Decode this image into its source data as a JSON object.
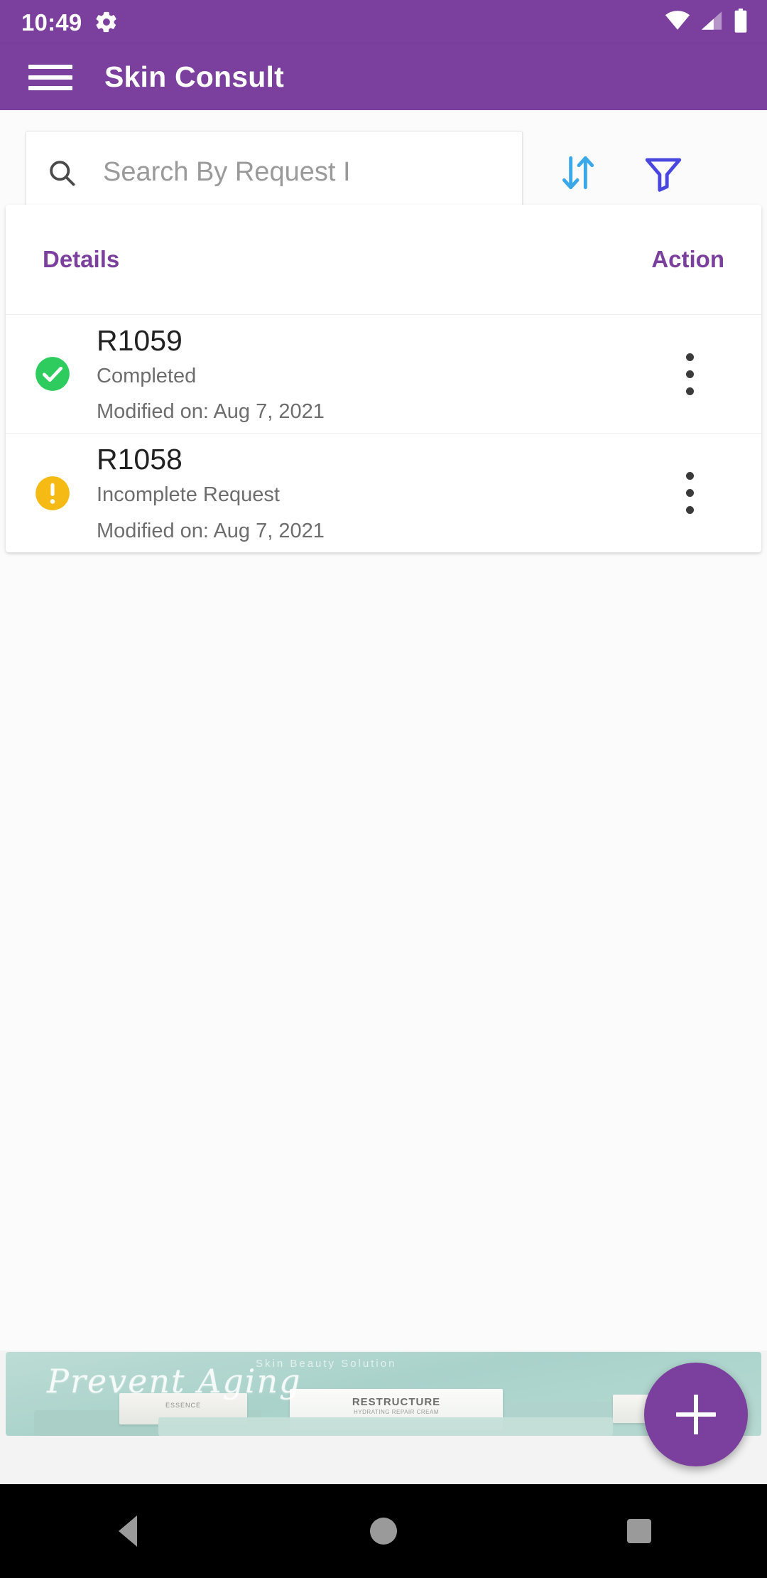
{
  "statusbar": {
    "time": "10:49",
    "icons": [
      "gear-icon",
      "wifi-icon",
      "cellular-signal-icon",
      "battery-icon"
    ],
    "background_color": "#7B3F9D"
  },
  "appbar": {
    "menu_icon": "hamburger-menu-icon",
    "title": "Skin Consult",
    "background_color": "#7B3F9D",
    "title_color": "#FFFFFF"
  },
  "search": {
    "icon": "search-icon",
    "placeholder": "Search By Request I",
    "value": "",
    "sort_icon": "sort-arrows-icon",
    "sort_color": "#3BA8E8",
    "filter_icon": "filter-funnel-icon",
    "filter_color": "#4A47E0"
  },
  "table": {
    "headers": {
      "details": "Details",
      "action": "Action"
    },
    "header_color": "#7B3F9D",
    "rows": [
      {
        "status_icon": "check-circle-icon",
        "status_color": "#2ECC5E",
        "request_id": "R1059",
        "status_text": "Completed",
        "modified": "Modified on: Aug 7, 2021",
        "action_icon": "kebab-menu-icon"
      },
      {
        "status_icon": "warning-circle-icon",
        "status_color": "#F5BB14",
        "request_id": "R1058",
        "status_text": "Incomplete Request",
        "modified": "Modified on: Aug 7, 2021",
        "action_icon": "kebab-menu-icon"
      }
    ]
  },
  "banner": {
    "script_text": "Prevent Aging",
    "small_text": "Skin Beauty Solution",
    "product_box_title": "RESTRUCTURE",
    "product_box_subtitle": "HYDRATING REPAIR CREAM",
    "side_box_text": "ESSENCE",
    "background_color": "#B0D6CE"
  },
  "fab": {
    "icon": "plus-icon",
    "label": "+",
    "color": "#7B3F9D"
  },
  "navbar": {
    "back": "back-triangle-icon",
    "home": "home-circle-icon",
    "recents": "recents-square-icon",
    "background_color": "#000000"
  }
}
